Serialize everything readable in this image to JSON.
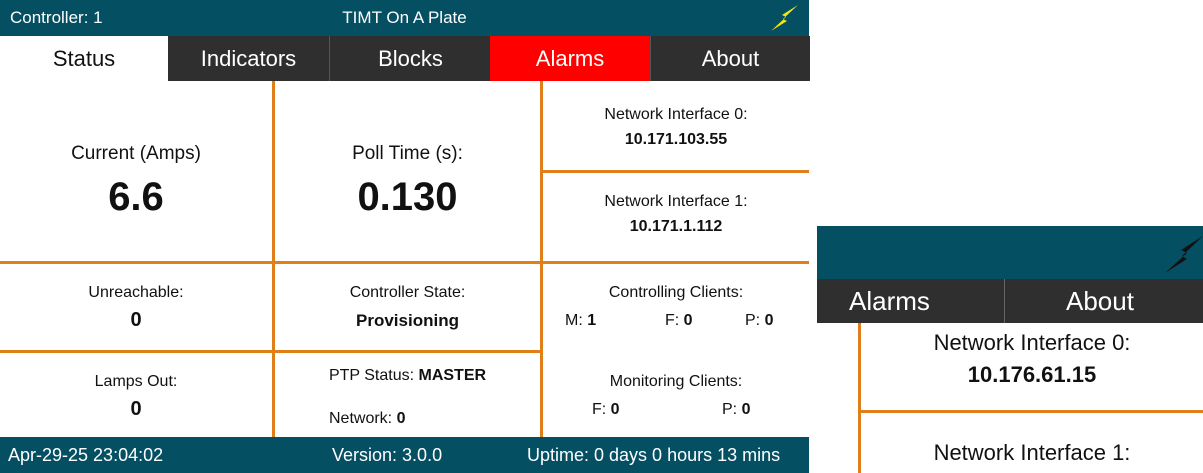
{
  "header": {
    "controller": "Controller: 1",
    "title": "TIMT On A Plate",
    "bolt_color": "#f5e611"
  },
  "tabs": [
    {
      "label": "Status",
      "active": true
    },
    {
      "label": "Indicators"
    },
    {
      "label": "Blocks"
    },
    {
      "label": "Alarms",
      "color": "#ff0000"
    },
    {
      "label": "About"
    }
  ],
  "status": {
    "current": {
      "label": "Current (Amps)",
      "value": "6.6"
    },
    "poll_time": {
      "label": "Poll Time (s):",
      "value": "0.130"
    },
    "net0": {
      "label": "Network Interface 0:",
      "value": "10.171.103.55"
    },
    "net1": {
      "label": "Network Interface 1:",
      "value": "10.171.1.112"
    },
    "unreachable": {
      "label": "Unreachable:",
      "value": "0"
    },
    "controller_state": {
      "label": "Controller State:",
      "value": "Provisioning"
    },
    "controlling_clients": {
      "label": "Controlling Clients:",
      "m_label": "M:",
      "m_value": "1",
      "f_label": "F:",
      "f_value": "0",
      "p_label": "P:",
      "p_value": "0"
    },
    "lamps_out": {
      "label": "Lamps Out:",
      "value": "0"
    },
    "ptp": {
      "label": "PTP Status:",
      "value": "MASTER",
      "network_label": "Network:",
      "network_value": "0"
    },
    "monitoring_clients": {
      "label": "Monitoring Clients:",
      "f_label": "F:",
      "f_value": "0",
      "p_label": "P:",
      "p_value": "0"
    }
  },
  "footer": {
    "datetime": "Apr-29-25 23:04:02",
    "version": "Version: 3.0.0",
    "uptime": "Uptime: 0 days 0 hours 13 mins"
  },
  "zoom": {
    "tabs": [
      "Alarms",
      "About"
    ],
    "net0": {
      "label": "Network Interface 0:",
      "value": "10.176.61.15"
    },
    "net1": {
      "label": "Network Interface 1:"
    }
  },
  "colors": {
    "header_bg": "#054f63",
    "tab_bg": "#2f2f2f",
    "alarm_tab": "#ff0000",
    "divider": "#e07f1a"
  }
}
